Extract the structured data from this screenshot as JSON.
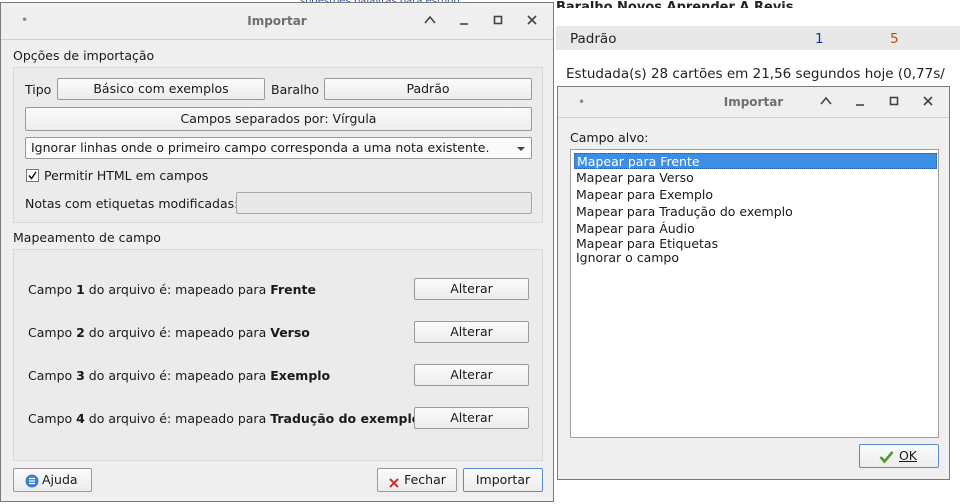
{
  "background": {
    "top_link": "sugestões palavras para estudo",
    "header": "Baralho       Novos Aprender A Revis",
    "deck_row": {
      "name": "Padrão",
      "new": "1",
      "learn": "5"
    },
    "studied": "Estudada(s) 28 cartões em 21,56 segundos hoje (0,77s/"
  },
  "import_window": {
    "title": "Importar",
    "options_group": {
      "title": "Opções de importação",
      "type_label": "Tipo",
      "type_value": "Básico com exemplos",
      "deck_label": "Baralho",
      "deck_value": "Padrão",
      "separator_button": "Campos separados por: Vírgula",
      "duplicate_option": "Ignorar linhas onde o primeiro campo corresponda a uma nota existente.",
      "allow_html_label": "Permitir HTML em campos",
      "allow_html_checked": true,
      "tags_label": "Notas com etiquetas modificadas:",
      "tags_value": ""
    },
    "mapping_group": {
      "title": "Mapeamento de campo",
      "rows": [
        {
          "prefix": "Campo ",
          "num": "1",
          "mid": " do arquivo é:  mapeado para ",
          "target": "Frente",
          "button": "Alterar"
        },
        {
          "prefix": "Campo ",
          "num": "2",
          "mid": " do arquivo é:  mapeado para ",
          "target": "Verso",
          "button": "Alterar"
        },
        {
          "prefix": "Campo ",
          "num": "3",
          "mid": " do arquivo é:  mapeado para ",
          "target": "Exemplo",
          "button": "Alterar"
        },
        {
          "prefix": "Campo ",
          "num": "4",
          "mid": " do arquivo é:  mapeado para ",
          "target": "Tradução do exemplo",
          "button": "Alterar"
        }
      ]
    },
    "help_button": "Ajuda",
    "close_button": "Fechar",
    "import_button": "Importar"
  },
  "field_window": {
    "title": "Importar",
    "label": "Campo alvo:",
    "items": [
      "Mapear para Frente",
      "Mapear para Verso",
      "Mapear para Exemplo",
      "Mapear para Tradução do exemplo",
      "Mapear para Áudio",
      "Mapear para Etiquetas",
      "Ignorar o campo"
    ],
    "selected_index": 0,
    "ok_button": "OK"
  },
  "colors": {
    "selection": "#3d8ee6",
    "new_count": "#1c2db0",
    "learn_count": "#c05000",
    "close_icon": "#d03030",
    "ok_check": "#4a9a2a",
    "help_icon": "#3a7fd0"
  },
  "icons": [
    "dot-icon",
    "chevron-up-icon",
    "minimize-icon",
    "maximize-icon",
    "close-icon",
    "help-icon",
    "close-x-icon",
    "checkmark-icon"
  ]
}
